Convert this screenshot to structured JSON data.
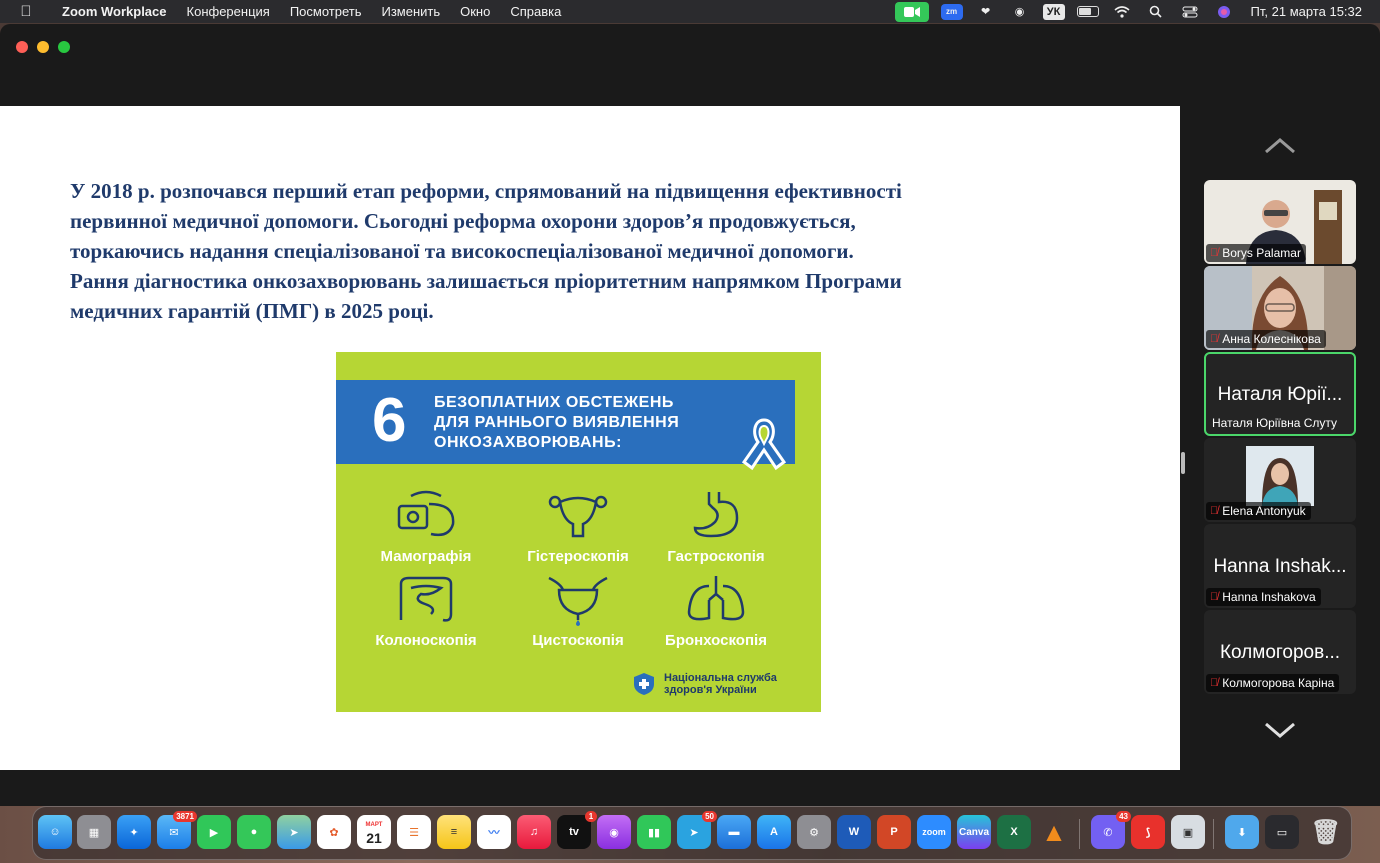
{
  "menubar": {
    "app_name": "Zoom Workplace",
    "items": [
      "Конференция",
      "Посмотреть",
      "Изменить",
      "Окно",
      "Справка"
    ],
    "keyboard_layout": "УК",
    "datetime": "Пт, 21 марта  15:32"
  },
  "slide": {
    "paragraph_lines": [
      "У 2018 р. розпочався перший етап реформи, спрямований на підвищення ефективності",
      "первинної медичної допомоги. Сьогодні реформа охорони здоров’я продовжується,",
      "торкаючись надання спеціалізованої та високоспеціалізованої медичної допомоги.",
      "Рання діагностика онкозахворювань залишається пріоритетним напрямком Програми",
      "медичних гарантій (ПМГ) в 2025 році."
    ],
    "infographic": {
      "number": "6",
      "heading_lines": [
        "БЕЗОПЛАТНИХ ОБСТЕЖЕНЬ",
        "ДЛЯ РАННЬОГО ВИЯВЛЕННЯ",
        "ОНКОЗАХВОРЮВАНЬ:"
      ],
      "exams": [
        "Мамографія",
        "Гістероскопія",
        "Гастроскопія",
        "Колоноскопія",
        "Цистоскопія",
        "Бронхоскопія"
      ],
      "org_lines": [
        "Національна служба",
        "здоров'я України"
      ],
      "colors": {
        "background": "#b6d634",
        "banner": "#2a6fbd",
        "text": "#ffffff"
      }
    }
  },
  "participants": [
    {
      "name": "Borys Palamar",
      "video": true,
      "muted": true
    },
    {
      "name": "Анна Колеснікова",
      "video": true,
      "muted": true
    },
    {
      "name": "Наталя Юріївна Слуту",
      "big_name": "Наталя Юрії...",
      "video": false,
      "muted": false,
      "active_speaker": true
    },
    {
      "name": "Elena Antonyuk",
      "video": true,
      "muted": true
    },
    {
      "name": "Hanna Inshakova",
      "big_name": "Hanna Inshak...",
      "video": false,
      "muted": true
    },
    {
      "name": "Колмогорова Каріна",
      "big_name": "Колмогоров...",
      "video": false,
      "muted": true
    }
  ],
  "dock": {
    "mail_badge": "3871",
    "calendar_month": "МАРТ",
    "calendar_day": "21",
    "tv_label": "tv",
    "tv_badge": "1",
    "telegram_badge": "50",
    "zoom_label": "zoom",
    "canva_label": "Canva",
    "viber_badge": "43"
  }
}
